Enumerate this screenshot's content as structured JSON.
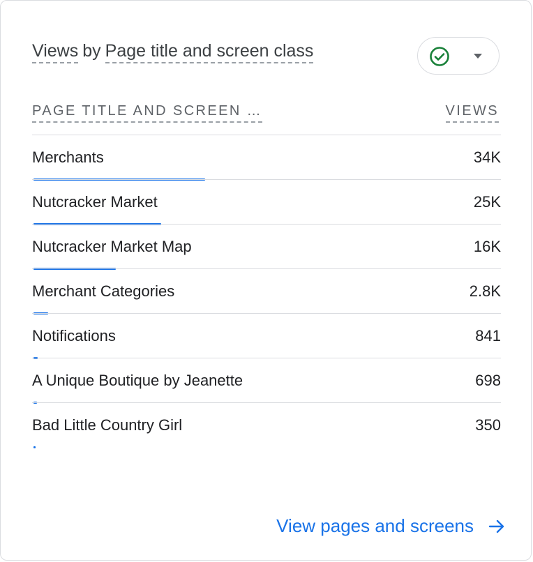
{
  "card": {
    "title_metric": "Views",
    "title_by": "by",
    "title_dimension": "Page title and screen class",
    "status_icon": "check-circle-icon",
    "dropdown_icon": "caret-down-icon",
    "colors": {
      "accent": "#1a73e8",
      "success": "#188038",
      "divider": "#dadce0"
    }
  },
  "table": {
    "col_dimension": "PAGE TITLE AND SCREEN …",
    "col_metric": "VIEWS",
    "rows": [
      {
        "name": "Merchants",
        "value": "34K",
        "share": 1.0
      },
      {
        "name": "Nutcracker Market",
        "value": "25K",
        "share": 0.745
      },
      {
        "name": "Nutcracker Market Map",
        "value": "16K",
        "share": 0.478
      },
      {
        "name": "Merchant Categories",
        "value": "2.8K",
        "share": 0.086
      },
      {
        "name": "Notifications",
        "value": "841",
        "share": 0.026
      },
      {
        "name": "A Unique Boutique by Jeanette",
        "value": "698",
        "share": 0.021
      },
      {
        "name": "Bad Little Country Girl",
        "value": "350",
        "share": 0.011
      }
    ]
  },
  "footer": {
    "link_label": "View pages and screens",
    "link_icon": "arrow-right-icon"
  }
}
